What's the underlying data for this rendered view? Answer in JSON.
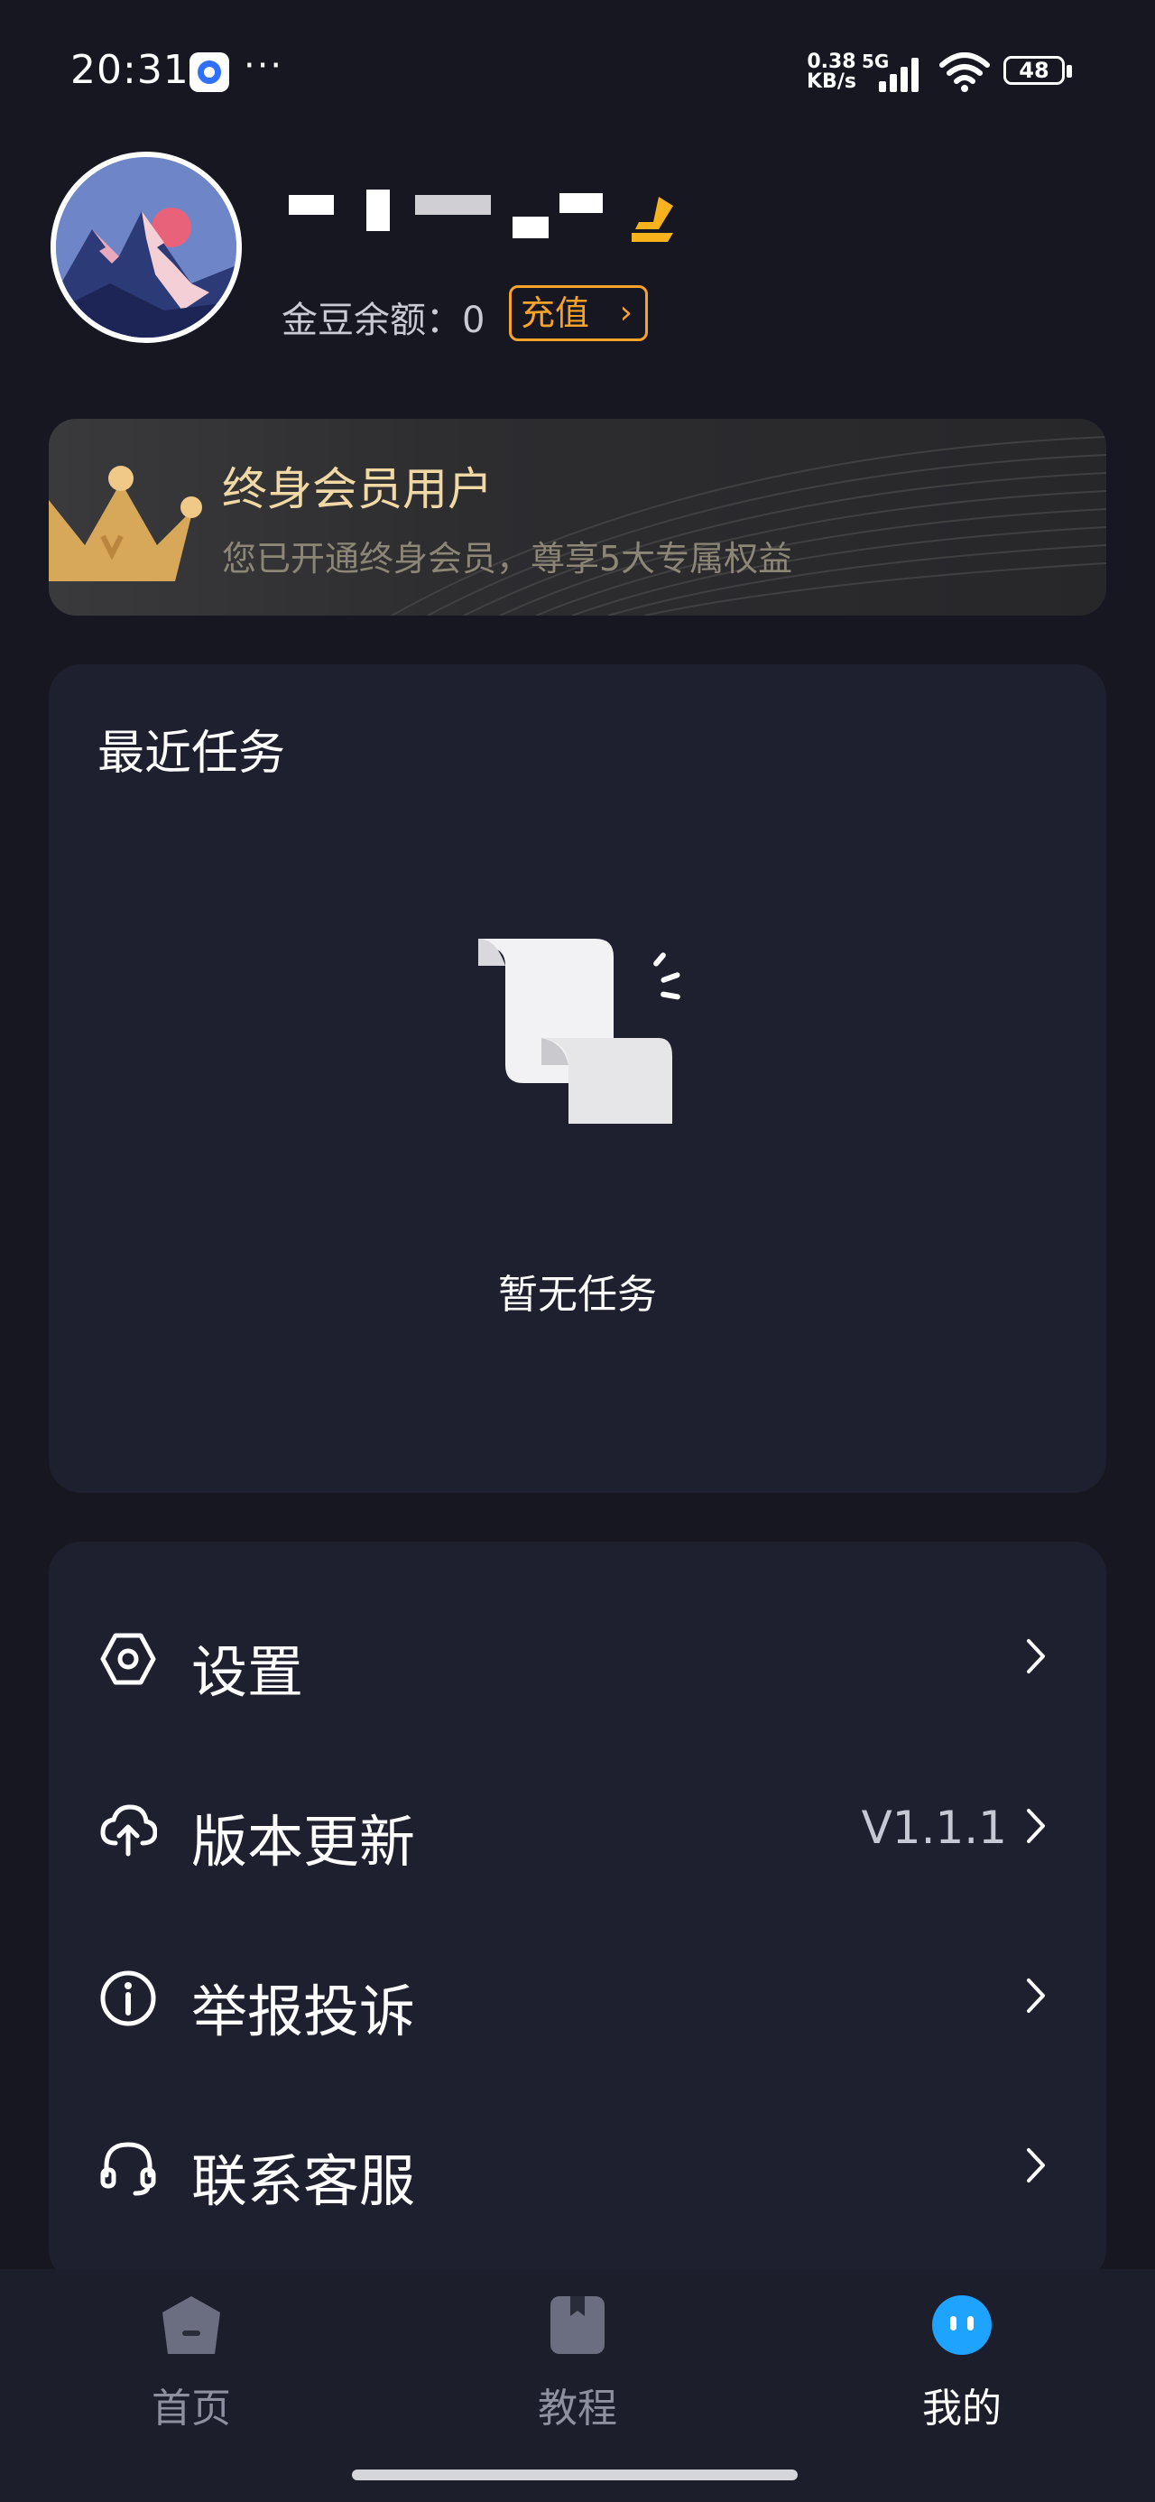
{
  "status_bar": {
    "time": "20:31",
    "dots": "···",
    "net_speed_value": "0.38",
    "net_speed_unit": "KB/s",
    "network_type": "5G",
    "battery": "48"
  },
  "profile": {
    "balance_label": "金豆余额：0",
    "recharge_label": "充值"
  },
  "member": {
    "title": "终身会员用户",
    "description": "您已开通终身会员，尊享5大专属权益"
  },
  "recent_tasks": {
    "title": "最近任务",
    "empty_text": "暂无任务"
  },
  "menu": {
    "items": [
      {
        "label": "设置",
        "icon": "settings-hexagon-icon"
      },
      {
        "label": "版本更新",
        "value": "V1.1.1",
        "icon": "cloud-upload-icon"
      },
      {
        "label": "举报投诉",
        "icon": "info-circle-icon"
      },
      {
        "label": "联系客服",
        "icon": "headset-icon"
      }
    ]
  },
  "bottom_nav": {
    "items": [
      {
        "label": "首页",
        "icon": "home-pentagon-icon",
        "active": false
      },
      {
        "label": "教程",
        "icon": "book-icon",
        "active": false
      },
      {
        "label": "我的",
        "icon": "face-icon",
        "active": true
      }
    ]
  },
  "colors": {
    "background": "#161720",
    "card": "#1e2030",
    "accent_orange": "#f7a22a",
    "active_blue": "#1ea3ff",
    "member_gold": "#f1d9a6"
  }
}
